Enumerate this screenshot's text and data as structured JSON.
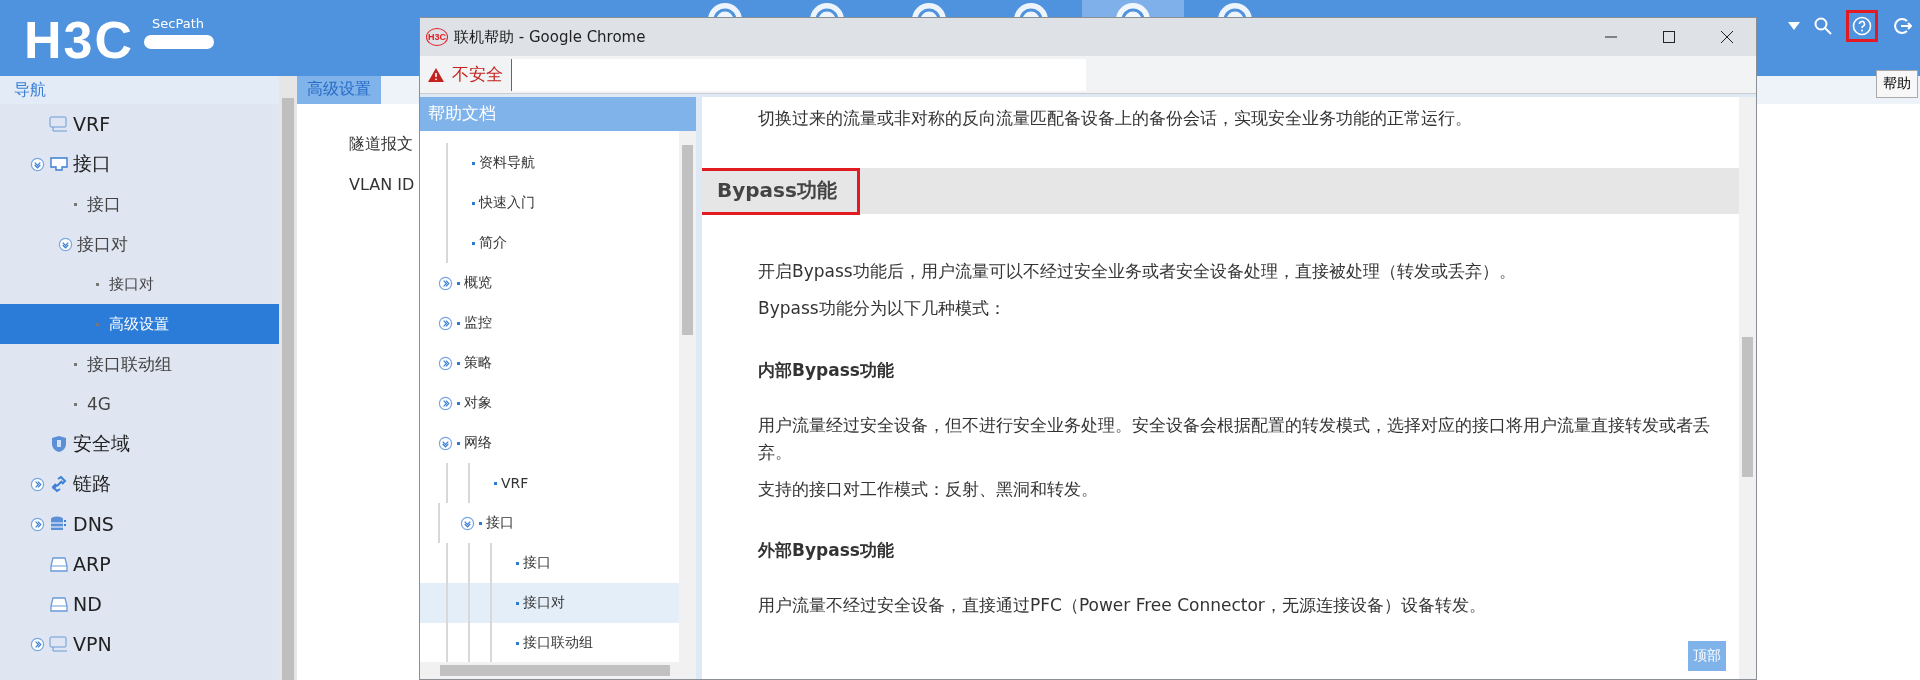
{
  "app": {
    "logo": "H3C",
    "product": "SecPath"
  },
  "top_nav": [
    {
      "selected": false
    },
    {
      "selected": false
    },
    {
      "selected": false
    },
    {
      "selected": false
    },
    {
      "selected": true
    },
    {
      "selected": false
    }
  ],
  "tooltip": "帮助",
  "nav": {
    "title": "导航",
    "items": [
      {
        "label": "VRF",
        "selected": false
      },
      {
        "label": "接口",
        "expanded": true,
        "selected": false,
        "children": [
          {
            "label": "接口",
            "selected": false
          },
          {
            "label": "接口对",
            "expanded": true,
            "selected": false,
            "children": [
              {
                "label": "接口对",
                "selected": false
              },
              {
                "label": "高级设置",
                "selected": true
              }
            ]
          },
          {
            "label": "接口联动组",
            "selected": false
          },
          {
            "label": "4G",
            "selected": false
          }
        ]
      },
      {
        "label": "安全域",
        "selected": false
      },
      {
        "label": "链路",
        "expanded": false,
        "selected": false
      },
      {
        "label": "DNS",
        "expanded": false,
        "selected": false
      },
      {
        "label": "ARP",
        "selected": false
      },
      {
        "label": "ND",
        "selected": false
      },
      {
        "label": "VPN",
        "expanded": false,
        "selected": false
      }
    ]
  },
  "breadcrumb": "高级设置",
  "main": {
    "fields": [
      "隧道报文",
      "VLAN ID"
    ]
  },
  "help_window": {
    "favicon": "H3C",
    "title": "联机帮助 - Google Chrome",
    "security": "不安全",
    "panel_title": "帮助文档",
    "tree": [
      {
        "label": "资料导航",
        "selected": false
      },
      {
        "label": "快速入门",
        "selected": false
      },
      {
        "label": "简介",
        "selected": false
      },
      {
        "label": "概览",
        "expanded": false,
        "selected": false
      },
      {
        "label": "监控",
        "expanded": false,
        "selected": false
      },
      {
        "label": "策略",
        "expanded": false,
        "selected": false
      },
      {
        "label": "对象",
        "expanded": false,
        "selected": false
      },
      {
        "label": "网络",
        "expanded": true,
        "selected": false,
        "children": [
          {
            "label": "VRF",
            "selected": false
          },
          {
            "label": "接口",
            "expanded": true,
            "selected": false,
            "children": [
              {
                "label": "接口",
                "selected": false
              },
              {
                "label": "接口对",
                "selected": true
              },
              {
                "label": "接口联动组",
                "selected": false
              }
            ]
          }
        ]
      }
    ],
    "content": [
      {
        "kind": "paragraph",
        "text": "切换过来的流量或非对称的反向流量匹配备设备上的备份会话，实现安全业务功能的正常运行。"
      },
      {
        "kind": "heading",
        "text": "Bypass功能",
        "highlighted": true
      },
      {
        "kind": "paragraph",
        "text": "开启Bypass功能后，用户流量可以不经过安全业务或者安全设备处理，直接被处理（转发或丢弃）。"
      },
      {
        "kind": "paragraph",
        "text": "Bypass功能分为以下几种模式："
      },
      {
        "kind": "subheading",
        "text": "内部Bypass功能"
      },
      {
        "kind": "paragraph",
        "text": "用户流量经过安全设备，但不进行安全业务处理。安全设备会根据配置的转发模式，选择对应的接口将用户流量直接转发或者丢弃。"
      },
      {
        "kind": "paragraph",
        "text": "支持的接口对工作模式：反射、黑洞和转发。"
      },
      {
        "kind": "subheading",
        "text": "外部Bypass功能"
      },
      {
        "kind": "paragraph",
        "text": "用户流量不经过安全设备，直接通过PFC（Power Free Connector，无源连接设备）设备转发。"
      }
    ],
    "top_button": "顶部"
  }
}
